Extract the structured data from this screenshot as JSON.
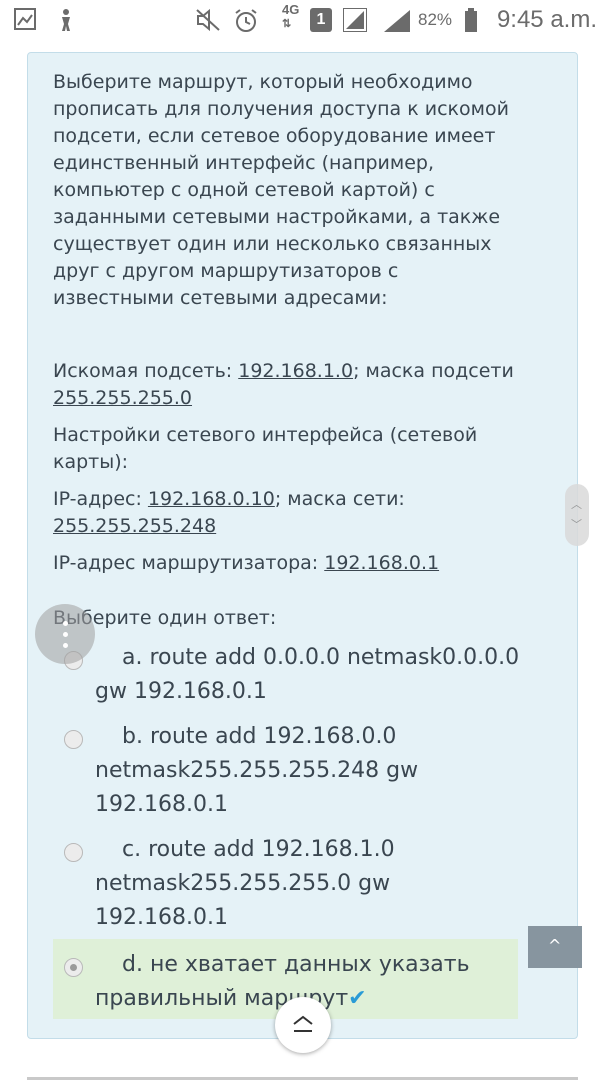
{
  "status_bar": {
    "network": "4G",
    "sim": "1",
    "battery": "82%",
    "time": "9:45 a.m."
  },
  "question": {
    "text": "Выберите маршрут, который необходимо прописать для получения доступа к искомой подсети, если сетевое оборудование имеет единственный интерфейс (например, компьютер с одной сетевой картой) с заданными сетевыми настройками, а также существует один или несколько связанных друг с другом маршрутизаторов с известными сетевыми адресами:",
    "subnet_label": "Искомая подсеть: ",
    "subnet_value": "192.168.1.0",
    "subnet_mask_label": "; маска подсети ",
    "subnet_mask_value": "255.255.255.0",
    "iface_label": "Настройки сетевого интерфейса (сетевой карты):",
    "ip_label": "IP-адрес: ",
    "ip_value": "192.168.0.10",
    "netmask_label": "; маска сети: ",
    "netmask_value": "255.255.255.248",
    "router_label": "IP-адрес маршрутизатора:  ",
    "router_value": "192.168.0.1",
    "prompt": "Выберите один ответ:"
  },
  "options": [
    {
      "text": "a. route add 0.0.0.0 netmask0.0.0.0 gw 192.168.0.1",
      "checked": false
    },
    {
      "text": "b. route add 192.168.0.0 netmask255.255.255.248 gw 192.168.0.1",
      "checked": false
    },
    {
      "text": "c. route add 192.168.1.0 netmask255.255.255.0 gw 192.168.0.1",
      "checked": false
    },
    {
      "text": "d. не хватает данных указать правильный маршрут",
      "checked": true,
      "correct_mark": "✔"
    }
  ],
  "colors": {
    "card_bg": "#e5f2f7",
    "correct_bg": "#dff0d8",
    "check_color": "#2a9bd6"
  }
}
